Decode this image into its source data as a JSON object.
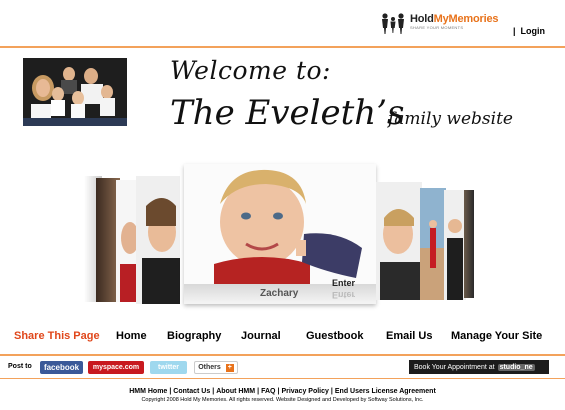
{
  "brand": {
    "name_part1": "Hold",
    "name_part2": "My",
    "name_part3": "Memories",
    "tagline": "SHARE YOUR MOMENTS",
    "login_sep": "|",
    "login": "Login"
  },
  "heading": {
    "welcome": "Welcome to:",
    "title": "The Eveleth’s",
    "subtitle": "family website"
  },
  "carousel": {
    "featured_name": "Zachary",
    "enter_label": "Enter"
  },
  "nav": {
    "share": "Share This Page",
    "items": [
      "Home",
      "Biography",
      "Journal",
      "Guestbook",
      "Email Us",
      "Manage Your Site"
    ]
  },
  "post_bar": {
    "label": "Post to",
    "facebook": "facebook",
    "myspace": "myspace.com",
    "twitter": "twitter",
    "others": "Others",
    "appointment": "Book Your Appointment at",
    "studio": "studio_ne"
  },
  "footer": {
    "links": [
      "HMM Home",
      "Contact Us",
      "About HMM",
      "FAQ",
      "Privacy Policy",
      "End Users License Agreement"
    ],
    "copyright": "Copyright 2008 Hold My Memories. All rights reserved. Website Designed and Developed by Softway Solutions, Inc."
  },
  "colors": {
    "accent": "#e8731c",
    "share_link": "#e0471b",
    "divider": "#f3a25b",
    "facebook": "#3b5998",
    "myspace": "#c8191f",
    "twitter": "#9fd8ee"
  }
}
